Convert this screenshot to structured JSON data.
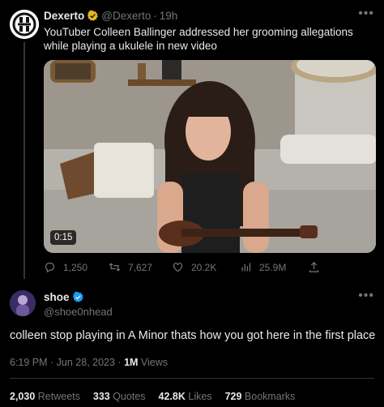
{
  "quoted": {
    "display_name": "Dexerto",
    "handle": "@Dexerto",
    "separator": "·",
    "time": "19h",
    "text": "YouTuber Colleen Ballinger addressed her grooming allegations while playing a ukulele in new video",
    "video_duration": "0:15",
    "stats": {
      "replies": "1,250",
      "retweets": "7,627",
      "likes": "20.2K",
      "views": "25.9M"
    }
  },
  "reply": {
    "display_name": "shoe",
    "handle": "@shoe0nhead",
    "text": "colleen stop playing in A Minor thats how you got here in the first place",
    "timestamp": "6:19 PM · Jun 28, 2023 · ",
    "views_count": "1M",
    "views_label": " Views",
    "retweets_count": "2,030",
    "retweets_label": "Retweets",
    "quotes_count": "333",
    "quotes_label": "Quotes",
    "likes_count": "42.8K",
    "likes_label": "Likes",
    "bookmarks_count": "729",
    "bookmarks_label": "Bookmarks"
  },
  "colors": {
    "background": "#000000",
    "text": "#e7e9ea",
    "muted": "#71767b",
    "verified_gold": "#e2b719",
    "verified_blue": "#1d9bf0"
  },
  "icons": [
    "reply-icon",
    "retweet-icon",
    "like-icon",
    "views-icon",
    "share-icon",
    "more-icon",
    "verified-badge-icon"
  ]
}
